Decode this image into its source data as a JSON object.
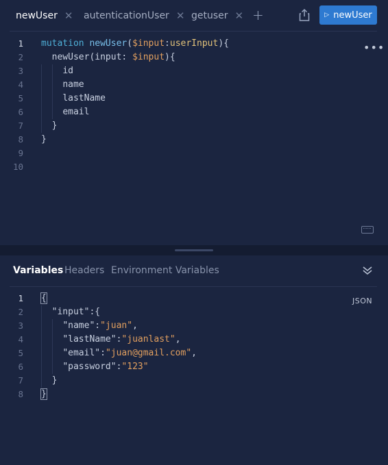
{
  "tabs": [
    {
      "label": "newUser",
      "active": true
    },
    {
      "label": "autenticationUser",
      "active": false
    },
    {
      "label": "getuser",
      "active": false
    }
  ],
  "toolbar": {
    "add_icon": "plus-icon",
    "share_icon": "share-icon",
    "run_label": "newUser",
    "run_color": "#2e7ad1"
  },
  "editor": {
    "line_numbers": [
      "1",
      "2",
      "3",
      "4",
      "5",
      "6",
      "7",
      "8",
      "9",
      "10"
    ],
    "lines": [
      "mutation newUser($input:userInput){",
      "  newUser(input: $input){",
      "    id",
      "    name",
      "    lastName",
      "    email",
      "  }",
      "}",
      "",
      ""
    ],
    "tokens": {
      "keyword": "mutation",
      "op_name": "newUser",
      "var": "$input",
      "type": "userInput",
      "field_call": "newUser",
      "arg": "input",
      "fields": [
        "id",
        "name",
        "lastName",
        "email"
      ]
    },
    "more_icon": "more-icon",
    "keyboard_icon": "keyboard-icon"
  },
  "panel": {
    "tabs": [
      {
        "label": "Variables",
        "active": true
      },
      {
        "label": "Headers",
        "active": false
      },
      {
        "label": "Environment Variables",
        "active": false
      }
    ],
    "collapse_icon": "chevrons-down-icon",
    "format_label": "JSON",
    "line_numbers": [
      "1",
      "2",
      "3",
      "4",
      "5",
      "6",
      "7",
      "8"
    ],
    "variables": {
      "key": "\"input\"",
      "entries": [
        {
          "key": "\"name\"",
          "value": "\"juan\"",
          "comma": ","
        },
        {
          "key": "\"lastName\"",
          "value": "\"juanlast\"",
          "comma": ","
        },
        {
          "key": "\"email\"",
          "value": "\"juan@gmail.com\"",
          "comma": ","
        },
        {
          "key": "\"password\"",
          "value": "\"123\"",
          "comma": ""
        }
      ]
    }
  }
}
